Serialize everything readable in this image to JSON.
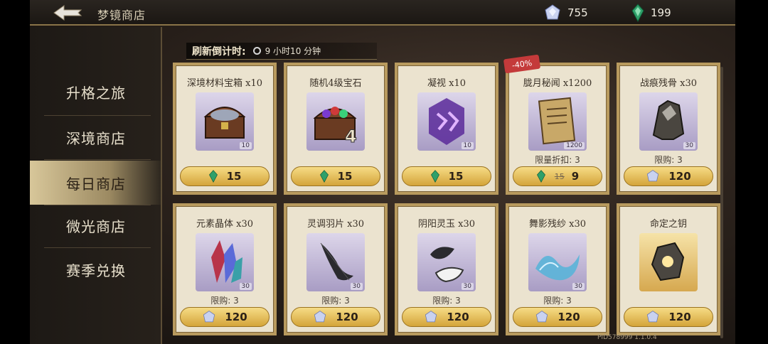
{
  "header": {
    "title": "梦镜商店",
    "currencies": [
      {
        "icon": "crystal-icon",
        "value": "755"
      },
      {
        "icon": "green-gem-icon",
        "value": "199"
      }
    ]
  },
  "sidebar": {
    "items": [
      {
        "label": "升格之旅",
        "active": false
      },
      {
        "label": "深境商店",
        "active": false
      },
      {
        "label": "每日商店",
        "active": true
      },
      {
        "label": "微光商店",
        "active": false
      },
      {
        "label": "赛季兑换",
        "active": false
      }
    ]
  },
  "refresh": {
    "label": "刷新倒计时:",
    "time": "9 小时10 分钟"
  },
  "items": [
    {
      "name": "深境材料宝箱 x10",
      "qty": "10",
      "limit": "",
      "price": "15",
      "currency": "green-gem-icon",
      "icon": "treasure-chest-icon"
    },
    {
      "name": "随机4级宝石",
      "qty": "",
      "limit": "",
      "price": "15",
      "currency": "green-gem-icon",
      "icon": "gem-chest-icon"
    },
    {
      "name": "凝视 x10",
      "qty": "10",
      "limit": "",
      "price": "15",
      "currency": "green-gem-icon",
      "icon": "rune-icon"
    },
    {
      "name": "胧月秘闻 x1200",
      "qty": "1200",
      "limit": "限量折扣: 3",
      "price": "9",
      "old_price": "15",
      "discount": "-40%",
      "currency": "green-gem-icon",
      "icon": "scroll-icon"
    },
    {
      "name": "战痕残骨 x30",
      "qty": "30",
      "limit": "限购: 3",
      "price": "120",
      "currency": "crystal-icon",
      "icon": "bone-icon"
    },
    {
      "name": "元素晶体 x30",
      "qty": "30",
      "limit": "限购: 3",
      "price": "120",
      "currency": "crystal-icon",
      "icon": "element-crystal-icon"
    },
    {
      "name": "灵调羽片 x30",
      "qty": "30",
      "limit": "限购: 3",
      "price": "120",
      "currency": "crystal-icon",
      "icon": "feather-icon"
    },
    {
      "name": "阴阳灵玉 x30",
      "qty": "30",
      "limit": "限购: 3",
      "price": "120",
      "currency": "crystal-icon",
      "icon": "jade-icon"
    },
    {
      "name": "舞影残纱 x30",
      "qty": "30",
      "limit": "限购: 3",
      "price": "120",
      "currency": "crystal-icon",
      "icon": "silk-icon"
    },
    {
      "name": "命定之钥",
      "qty": "",
      "limit": "",
      "price": "120",
      "currency": "crystal-icon",
      "icon": "key-stone-icon"
    }
  ],
  "footer": {
    "pid": "PID578999  1.1.0.4"
  },
  "colors": {
    "green_gem": "#2fa06a",
    "crystal": "#b9c4e6",
    "button_gold": "#e8c260",
    "discount_red": "#c43a3a"
  }
}
